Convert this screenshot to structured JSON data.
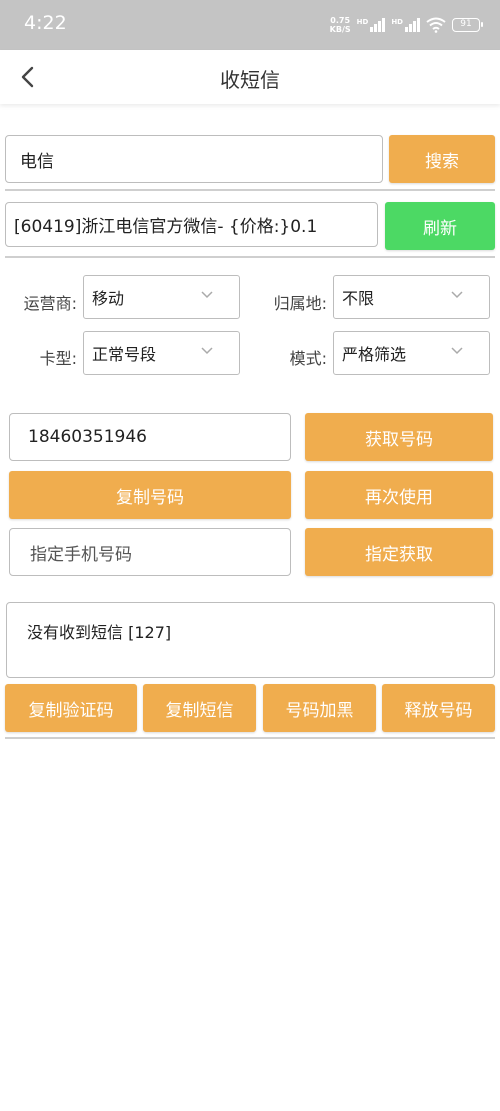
{
  "status": {
    "time": "4:22",
    "net_speed_top": "0.75",
    "net_speed_bottom": "KB/S",
    "hd1": "HD",
    "hd2": "HD",
    "battery": "91"
  },
  "header": {
    "title": "收短信",
    "back_icon": "chevron-left-icon"
  },
  "search": {
    "value": "电信",
    "button": "搜索"
  },
  "project": {
    "value": "[60419]浙江电信官方微信- {价格:}0.1",
    "refresh_button": "刷新"
  },
  "filters": {
    "operator_label": "运营商:",
    "operator_value": "移动",
    "region_label": "归属地:",
    "region_value": "不限",
    "card_label": "卡型:",
    "card_value": "正常号段",
    "mode_label": "模式:",
    "mode_value": "严格筛选"
  },
  "number": {
    "value": "18460351946",
    "get_button": "获取号码",
    "copy_button": "复制号码",
    "reuse_button": "再次使用",
    "specify_placeholder": "指定手机号码",
    "specify_button": "指定获取"
  },
  "sms": {
    "message": "没有收到短信 [127]",
    "copy_code_button": "复制验证码",
    "copy_sms_button": "复制短信",
    "blacklist_button": "号码加黑",
    "release_button": "释放号码"
  },
  "colors": {
    "accent": "#f0ad4e",
    "green": "#4cd964",
    "status_bar": "#c4c4c4"
  }
}
